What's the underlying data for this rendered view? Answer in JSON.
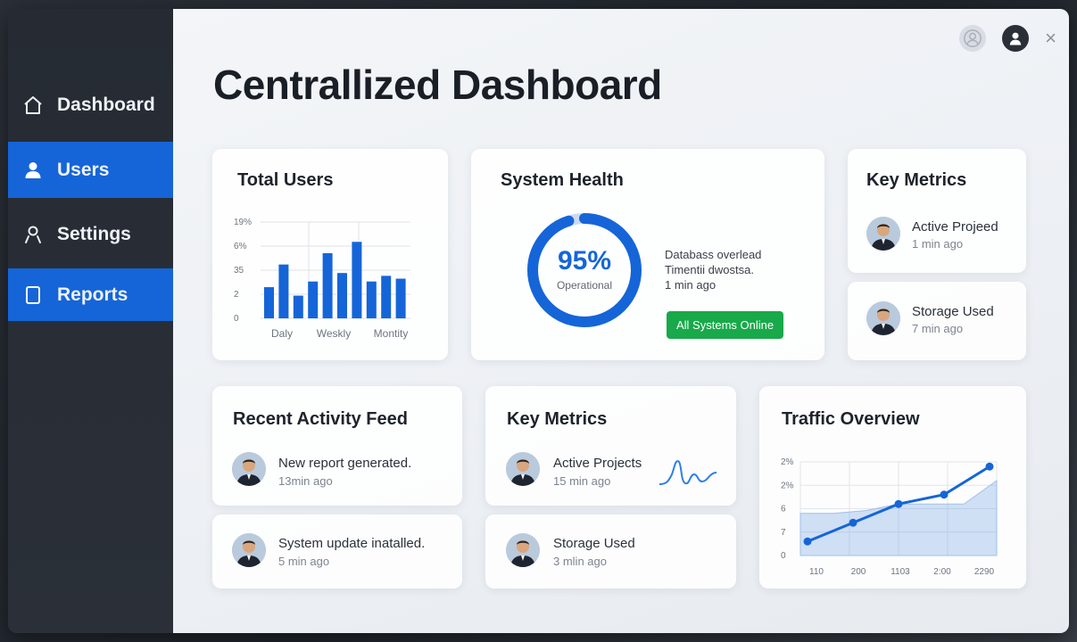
{
  "sidebar": {
    "items": [
      {
        "label": "Dashboard",
        "icon": "home-icon",
        "active": false
      },
      {
        "label": "Users",
        "icon": "user-icon",
        "active": true
      },
      {
        "label": "Settings",
        "icon": "person-outline-icon",
        "active": false
      },
      {
        "label": "Reports",
        "icon": "document-icon",
        "active": true
      }
    ]
  },
  "header": {
    "title": "Centrallized Dashboard",
    "icons": [
      "profile-ghost-icon",
      "account-icon",
      "close-icon"
    ],
    "close_glyph": "×"
  },
  "total_users": {
    "title": "Total Users",
    "chart_data": {
      "type": "bar",
      "title": "Total Users",
      "y_ticks": [
        "19%",
        "6%",
        "35",
        "2",
        "0"
      ],
      "x_labels": [
        "Daly",
        "Weskly",
        "Montity"
      ],
      "values": [
        5.5,
        9.5,
        4,
        6.5,
        11.5,
        8,
        13.5,
        6.5,
        7.5,
        7
      ],
      "ylim": [
        0,
        17
      ],
      "color": "#1565d8",
      "grid": true
    }
  },
  "system_health": {
    "title": "System Health",
    "percent": "95%",
    "percent_value": 0.95,
    "status": "Operational",
    "line1": "Databass overlead",
    "line2": "Timentii dwostsa.",
    "line3": "1 min ago",
    "badge": "All Systems Online",
    "badge_color": "#18a94a",
    "ring_color": "#1565d8"
  },
  "key_metrics_top": {
    "title": "Key Metrics",
    "items": [
      {
        "title": "Active Projeed",
        "sub": "1 min ago"
      },
      {
        "title": "Storage Used",
        "sub": "7 min ago"
      }
    ]
  },
  "activity_feed": {
    "title": "Recent Activity Feed",
    "items": [
      {
        "title": "New report generated.",
        "sub": "13min ago"
      },
      {
        "title": "System update inatalled.",
        "sub": "5 min ago"
      }
    ]
  },
  "key_metrics_bottom": {
    "title": "Key Metrics",
    "items": [
      {
        "title": "Active Projects",
        "sub": "15 min ago"
      },
      {
        "title": "Storage Used",
        "sub": "3 mlin ago"
      }
    ]
  },
  "traffic": {
    "title": "Traffic Overview",
    "chart_data": {
      "type": "line",
      "title": "Traffic Overview",
      "y_ticks": [
        "2%",
        "2%",
        "6",
        "7",
        "0"
      ],
      "x_labels": [
        "110",
        "200",
        "1103",
        "2:00",
        "2290"
      ],
      "series": [
        {
          "values": [
            1.5,
            3.5,
            5.5,
            6.5,
            9.5
          ],
          "color": "#1565d8"
        }
      ],
      "area": [
        4.5,
        4.5,
        4.8,
        5.5,
        5.5,
        5.5,
        8.0
      ],
      "ylim": [
        0,
        10
      ],
      "grid": true
    }
  }
}
